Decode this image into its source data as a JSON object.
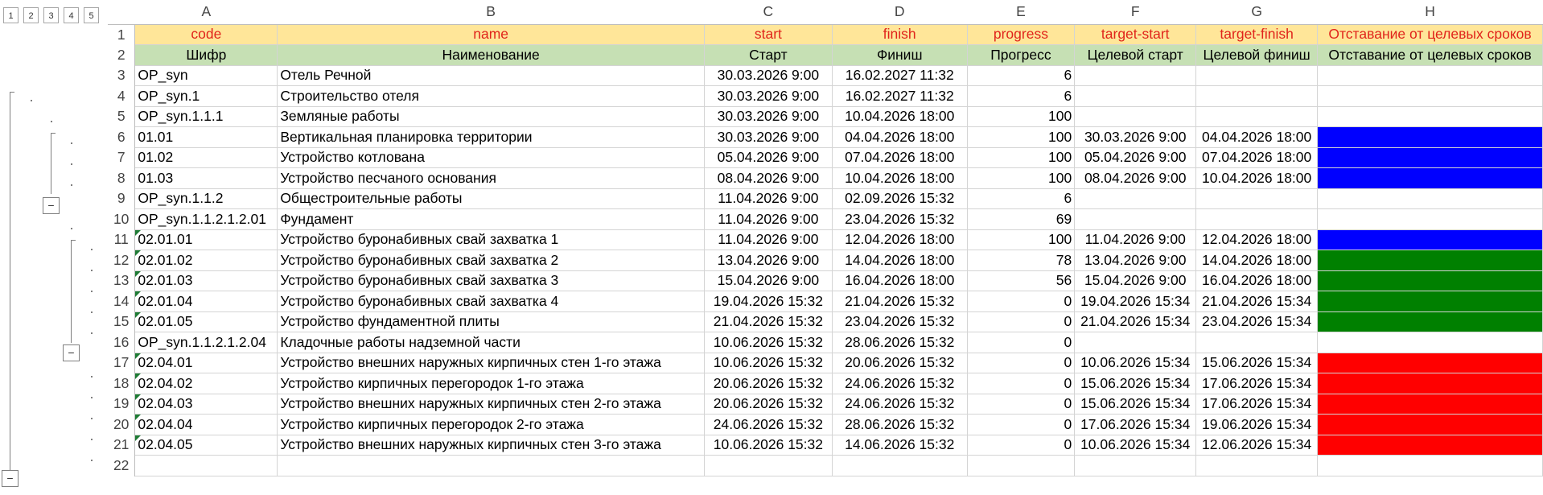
{
  "outline": {
    "levels": [
      "1",
      "2",
      "3",
      "4",
      "5"
    ],
    "collapse_symbol": "−"
  },
  "columns": [
    "A",
    "B",
    "C",
    "D",
    "E",
    "F",
    "G",
    "H"
  ],
  "row_numbers": [
    "1",
    "2",
    "3",
    "4",
    "5",
    "6",
    "7",
    "8",
    "9",
    "10",
    "11",
    "12",
    "13",
    "14",
    "15",
    "16",
    "17",
    "18",
    "19",
    "20",
    "21",
    "22"
  ],
  "header_keys": [
    "code",
    "name",
    "start",
    "finish",
    "progress",
    "target-start",
    "target-finish",
    "Отставание от целевых сроков"
  ],
  "header_labels": [
    "Шифр",
    "Наименование",
    "Старт",
    "Финиш",
    "Прогресс",
    "Целевой старт",
    "Целевой финиш",
    "Отставание от целевых сроков"
  ],
  "status_colors": {
    "blue": "#0000ff",
    "green": "#008000",
    "red": "#ff0000",
    "none": "#ffffff"
  },
  "rows": [
    {
      "code": "OP_syn",
      "name": "Отель Речной",
      "start": "30.03.2026 9:00",
      "finish": "16.02.2027 11:32",
      "progress": "6",
      "tstart": "",
      "tfinish": "",
      "status": "none",
      "flag": false
    },
    {
      "code": "OP_syn.1",
      "name": "Строительство отеля",
      "start": "30.03.2026 9:00",
      "finish": "16.02.2027 11:32",
      "progress": "6",
      "tstart": "",
      "tfinish": "",
      "status": "none",
      "flag": false
    },
    {
      "code": "OP_syn.1.1.1",
      "name": "Земляные работы",
      "start": "30.03.2026 9:00",
      "finish": "10.04.2026 18:00",
      "progress": "100",
      "tstart": "",
      "tfinish": "",
      "status": "none",
      "flag": false
    },
    {
      "code": "01.01",
      "name": "Вертикальная планировка территории",
      "start": "30.03.2026 9:00",
      "finish": "04.04.2026 18:00",
      "progress": "100",
      "tstart": "30.03.2026 9:00",
      "tfinish": "04.04.2026 18:00",
      "status": "blue",
      "flag": false
    },
    {
      "code": "01.02",
      "name": "Устройство котлована",
      "start": "05.04.2026 9:00",
      "finish": "07.04.2026 18:00",
      "progress": "100",
      "tstart": "05.04.2026 9:00",
      "tfinish": "07.04.2026 18:00",
      "status": "blue",
      "flag": false
    },
    {
      "code": "01.03",
      "name": "Устройство песчаного основания",
      "start": "08.04.2026 9:00",
      "finish": "10.04.2026 18:00",
      "progress": "100",
      "tstart": "08.04.2026 9:00",
      "tfinish": "10.04.2026 18:00",
      "status": "blue",
      "flag": false
    },
    {
      "code": "OP_syn.1.1.2",
      "name": "Общестроительные работы",
      "start": "11.04.2026 9:00",
      "finish": "02.09.2026 15:32",
      "progress": "6",
      "tstart": "",
      "tfinish": "",
      "status": "none",
      "flag": false
    },
    {
      "code": "OP_syn.1.1.2.1.2.01",
      "name": "Фундамент",
      "start": "11.04.2026 9:00",
      "finish": "23.04.2026 15:32",
      "progress": "69",
      "tstart": "",
      "tfinish": "",
      "status": "none",
      "flag": false
    },
    {
      "code": "02.01.01",
      "name": "Устройство буронабивных  свай захватка 1",
      "start": "11.04.2026 9:00",
      "finish": "12.04.2026 18:00",
      "progress": "100",
      "tstart": "11.04.2026 9:00",
      "tfinish": "12.04.2026 18:00",
      "status": "blue",
      "flag": true
    },
    {
      "code": "02.01.02",
      "name": "Устройство буронабивных  свай захватка 2",
      "start": "13.04.2026 9:00",
      "finish": "14.04.2026 18:00",
      "progress": "78",
      "tstart": "13.04.2026 9:00",
      "tfinish": "14.04.2026 18:00",
      "status": "green",
      "flag": true
    },
    {
      "code": "02.01.03",
      "name": "Устройство буронабивных  свай захватка 3",
      "start": "15.04.2026 9:00",
      "finish": "16.04.2026 18:00",
      "progress": "56",
      "tstart": "15.04.2026 9:00",
      "tfinish": "16.04.2026 18:00",
      "status": "green",
      "flag": true
    },
    {
      "code": "02.01.04",
      "name": "Устройство буронабивных  свай захватка 4",
      "start": "19.04.2026 15:32",
      "finish": "21.04.2026 15:32",
      "progress": "0",
      "tstart": "19.04.2026 15:34",
      "tfinish": "21.04.2026 15:34",
      "status": "green",
      "flag": true
    },
    {
      "code": "02.01.05",
      "name": "Устройство фундаментной плиты",
      "start": "21.04.2026 15:32",
      "finish": "23.04.2026 15:32",
      "progress": "0",
      "tstart": "21.04.2026 15:34",
      "tfinish": "23.04.2026 15:34",
      "status": "green",
      "flag": true
    },
    {
      "code": "OP_syn.1.1.2.1.2.04",
      "name": "Кладочные работы надземной части",
      "start": "10.06.2026 15:32",
      "finish": "28.06.2026 15:32",
      "progress": "0",
      "tstart": "",
      "tfinish": "",
      "status": "none",
      "flag": false
    },
    {
      "code": "02.04.01",
      "name": "Устройство внешних наружных кирпичных  стен 1-го этажа",
      "start": "10.06.2026 15:32",
      "finish": "20.06.2026 15:32",
      "progress": "0",
      "tstart": "10.06.2026 15:34",
      "tfinish": "15.06.2026 15:34",
      "status": "red",
      "flag": true
    },
    {
      "code": "02.04.02",
      "name": "Устройство кирпичных перегородок 1-го этажа",
      "start": "20.06.2026 15:32",
      "finish": "24.06.2026 15:32",
      "progress": "0",
      "tstart": "15.06.2026 15:34",
      "tfinish": "17.06.2026 15:34",
      "status": "red",
      "flag": true
    },
    {
      "code": "02.04.03",
      "name": "Устройство внешних наружных кирпичных  стен 2-го этажа",
      "start": "20.06.2026 15:32",
      "finish": "24.06.2026 15:32",
      "progress": "0",
      "tstart": "15.06.2026 15:34",
      "tfinish": "17.06.2026 15:34",
      "status": "red",
      "flag": true
    },
    {
      "code": "02.04.04",
      "name": "Устройство кирпичных перегородок 2-го этажа",
      "start": "24.06.2026 15:32",
      "finish": "28.06.2026 15:32",
      "progress": "0",
      "tstart": "17.06.2026 15:34",
      "tfinish": "19.06.2026 15:34",
      "status": "red",
      "flag": true
    },
    {
      "code": "02.04.05",
      "name": "Устройство внешних наружных кирпичных  стен 3-го этажа",
      "start": "10.06.2026 15:32",
      "finish": "14.06.2026 15:32",
      "progress": "0",
      "tstart": "10.06.2026 15:34",
      "tfinish": "12.06.2026 15:34",
      "status": "red",
      "flag": true
    }
  ]
}
